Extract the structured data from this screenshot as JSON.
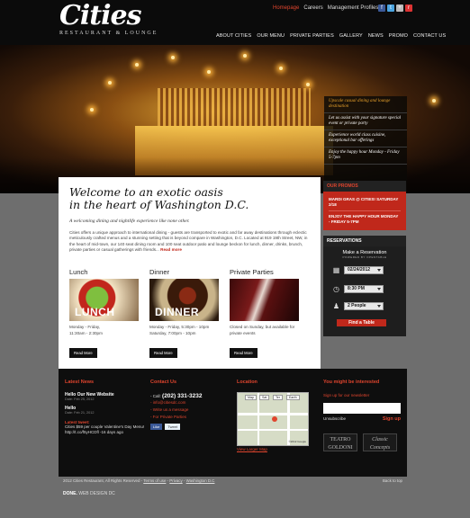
{
  "header": {
    "logo_text": "Cities",
    "logo_sub": "RESTAURANT & LOUNGE",
    "top_links": [
      "Homepage",
      "Careers",
      "Management Profiles"
    ],
    "nav": [
      "ABOUT CITIES",
      "OUR MENU",
      "PRIVATE PARTIES",
      "GALLERY",
      "NEWS",
      "PROMO",
      "CONTACT US"
    ]
  },
  "hero_panel": [
    "Upscale casual dining and lounge destination",
    "Let us assist with your signature special event or private party",
    "Experience world class cuisine, exceptional bar offerings",
    "Enjoy the happy hour Monday - Friday 5-7pm"
  ],
  "main": {
    "welcome_line1": "Welcome to an exotic oasis",
    "welcome_line2": "in the heart of Washington D.C.",
    "tagline": "A welcoming dining and nightlife experience like none other.",
    "intro": "Cities offers a unique approach to international dining - guests are transported to exotic and far away destinations through eclectic meticulously crafted menus and a stunning setting that is beyond compare in Washington, D.C. Located at 919 19th Street, NW, in the heart of mid-town, our 140 seat dining room and 100 seat outdoor patio and lounge beckon for lunch, dinner, drinks, brunch, private parties or casual gatherings with friends...",
    "read_more": "Read more",
    "cards": [
      {
        "title": "Lunch",
        "img_label": "LUNCH",
        "line1": "Monday - Friday,",
        "line2": "11:30am - 2:30pm",
        "button": "Read More"
      },
      {
        "title": "Dinner",
        "img_label": "DINNER",
        "line1": "Monday - Friday, 5:30pm - 10pm",
        "line2": "Saturday, 7:00pm - 10pm",
        "button": "Read More"
      },
      {
        "title": "Private Parties",
        "img_label": "",
        "line1": "Closed on Sunday, but available for",
        "line2": "private events",
        "button": "Read More"
      }
    ]
  },
  "sidebar": {
    "promos_heading": "OUR PROMOS",
    "promos": [
      "MARDI GRAS @ CITIES! SATURDAY 2/18",
      "ENJOY THE HAPPY HOUR MONDAY - FRIDAY 5-7PM"
    ],
    "reservations_heading": "RESERVATIONS",
    "make_reservation": "Make a Reservation",
    "powered_by": "POWERED BY OPENTABLE",
    "date": "02/24/2012",
    "time": "8:30 PM",
    "people": "2 People",
    "find_table": "Find a Table"
  },
  "footer": {
    "news": {
      "heading": "Latest News",
      "items": [
        {
          "title": "Hello Our New Website",
          "date": "Date: Feb 25, 2012"
        },
        {
          "title": "Hello",
          "date": "Date: Feb 21, 2012"
        }
      ],
      "tweet_label": "Latest tweet:",
      "tweet": "Cities $59 per couple Valentine's Day Menu! http://t.co/f5yHCDfl -16 days ago"
    },
    "contact": {
      "heading": "Contact Us",
      "phone_label": "- Call:",
      "phone": "(202) 331-3232",
      "links": [
        "- info@citiesdc.com",
        "- Write us a message",
        "- For Private Parties"
      ],
      "like": "Like",
      "tweet": "Tweet"
    },
    "location": {
      "heading": "Location",
      "tabs": [
        "Map",
        "Sat",
        "Ter",
        "Earth"
      ],
      "credit": "©2012 Google",
      "view_larger": "View Larger Map"
    },
    "interest": {
      "heading": "You might be interested",
      "newsletter": "Sign up for our newsletter",
      "unsubscribe": "Unsubscribe",
      "signup": "Sign up",
      "logos": [
        "TEATRO GOLDONI",
        "Classic Concepts"
      ]
    }
  },
  "bottom": {
    "copyright": "2012 Cities Restaurant, All Rights Reserved -",
    "links": [
      "Terms of use",
      "Privacy",
      "Washington D.C"
    ],
    "back_to_top": "Back to top",
    "credit_brand": "DONE.",
    "credit_text": "WEB DESIGN DC"
  }
}
